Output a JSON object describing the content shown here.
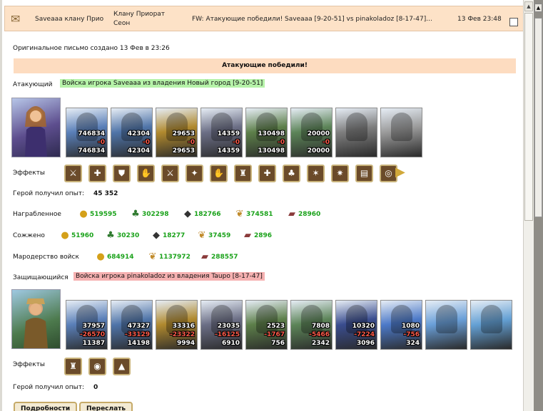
{
  "header": {
    "sender": "Saveaaa клану Прио",
    "recipient_line1": "Клану Приорат",
    "recipient_line2": "Сеон",
    "subject": "FW: Атакующие победили! Saveaaa [9-20-51] vs pinakoladoz [8-17-47]...",
    "date": "13 Фев 23:48"
  },
  "original_note": "Оригинальное письмо создано 13 Фев в 23:26",
  "banner": "Атакующие победили!",
  "attacker": {
    "label": "Атакующий",
    "army": "Войска игрока Saveaaa из владения Новый город [9-20-51]",
    "units": [
      {
        "top": "746834",
        "mid": "-0",
        "bottom": "746834",
        "color": "#5a7fb8"
      },
      {
        "top": "42304",
        "mid": "-0",
        "bottom": "42304",
        "color": "#4f74a8"
      },
      {
        "top": "29653",
        "mid": "-0",
        "bottom": "29653",
        "color": "#b0892e"
      },
      {
        "top": "14359",
        "mid": "-0",
        "bottom": "14359",
        "color": "#6b6e85"
      },
      {
        "top": "130498",
        "mid": "-0",
        "bottom": "130498",
        "color": "#5d7f4a"
      },
      {
        "top": "20000",
        "mid": "-0",
        "bottom": "20000",
        "color": "#5c8458"
      },
      {
        "top": "",
        "mid": "",
        "bottom": "",
        "color": "#7e7e7e"
      },
      {
        "top": "",
        "mid": "",
        "bottom": "",
        "color": "#9a9a9a"
      }
    ],
    "effects_label": "Эффекты",
    "effects": [
      "⚔",
      "✚",
      "⛊",
      "✋",
      "⚔",
      "✦",
      "✋",
      "♜",
      "✚",
      "♣",
      "✶",
      "✷",
      "▤",
      "◎"
    ],
    "exp_label": "Герой получил опыт:",
    "exp_value": "45 352",
    "looted_label": "Награбленное",
    "looted": [
      "519595",
      "302298",
      "182766",
      "374581",
      "28960"
    ],
    "burned_label": "Сожжено",
    "burned": [
      "51960",
      "30230",
      "18277",
      "37459",
      "2896"
    ],
    "marauding_label": "Мародерство войск",
    "marauding": [
      "684914",
      "1137972",
      "288557"
    ]
  },
  "defender": {
    "label": "Защищающийся",
    "army": "Войска игрока pinakoladoz из владения Tauрo [8-17-47]",
    "units": [
      {
        "top": "37957",
        "mid": "-26570",
        "bottom": "11387",
        "color": "#5a7fb8"
      },
      {
        "top": "47327",
        "mid": "-33129",
        "bottom": "14198",
        "color": "#4f74a8"
      },
      {
        "top": "33316",
        "mid": "-23322",
        "bottom": "9994",
        "color": "#b0892e"
      },
      {
        "top": "23035",
        "mid": "-16125",
        "bottom": "6910",
        "color": "#6b6e85"
      },
      {
        "top": "2523",
        "mid": "-1767",
        "bottom": "756",
        "color": "#5d7f4a"
      },
      {
        "top": "7808",
        "mid": "-5466",
        "bottom": "2342",
        "color": "#5c8458"
      },
      {
        "top": "10320",
        "mid": "-7224",
        "bottom": "3096",
        "color": "#3a4d8f"
      },
      {
        "top": "1080",
        "mid": "-756",
        "bottom": "324",
        "color": "#4c79c8"
      },
      {
        "top": "",
        "mid": "",
        "bottom": "",
        "color": "#6a9fd8"
      },
      {
        "top": "",
        "mid": "",
        "bottom": "",
        "color": "#64a0d4"
      }
    ],
    "effects_label": "Эффекты",
    "effects": [
      "♜",
      "◉",
      "▲"
    ],
    "exp_label": "Герой получил опыт:",
    "exp_value": "0"
  },
  "buttons": {
    "details": "Подробности",
    "forward": "Переслать"
  },
  "icons": {
    "gold": "●",
    "wood": "♣",
    "ore": "◆",
    "grain": "❦",
    "clay": "▰"
  },
  "colors": {
    "header_bg": "#fde2c7",
    "banner_bg": "#fddcc0",
    "attacker_tag": "#b6f3a9",
    "defender_tag": "#f6b1b1",
    "resource_value": "#1aa21a",
    "loss": "#ff5a4a"
  }
}
